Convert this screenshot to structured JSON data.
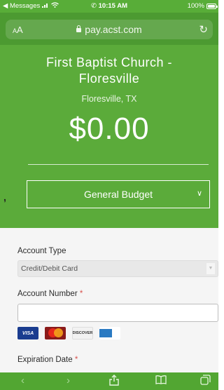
{
  "status_bar": {
    "back_label": "◀ Messages",
    "time": "10:15 AM",
    "battery": "100%",
    "battery_level": 1.0
  },
  "url_bar": {
    "text_size_label_small": "A",
    "text_size_label_large": "A",
    "domain": "pay.acst.com",
    "reload_icon": "reload-icon"
  },
  "hero": {
    "church_name": "First Baptist Church - Floresville",
    "church_location": "Floresville, TX",
    "amount": "$0.00",
    "fund": {
      "selected": "General Budget"
    }
  },
  "stray_mark": ",",
  "form": {
    "account_type": {
      "label": "Account Type",
      "value": "Credit/Debit Card"
    },
    "account_number": {
      "label": "Account Number",
      "required_marker": "*",
      "value": ""
    },
    "card_logos": [
      "VISA",
      "MasterCard",
      "DISCOVER",
      "AMEX"
    ],
    "expiration_date": {
      "label": "Expiration Date",
      "required_marker": "*"
    }
  },
  "toolbar": {
    "items": [
      "back-icon",
      "forward-icon",
      "share-icon",
      "bookmarks-icon",
      "tabs-icon"
    ]
  },
  "colors": {
    "brand_green": "#5bab3a",
    "url_bar_green": "#4c9a31",
    "required_red": "#d9534f"
  }
}
